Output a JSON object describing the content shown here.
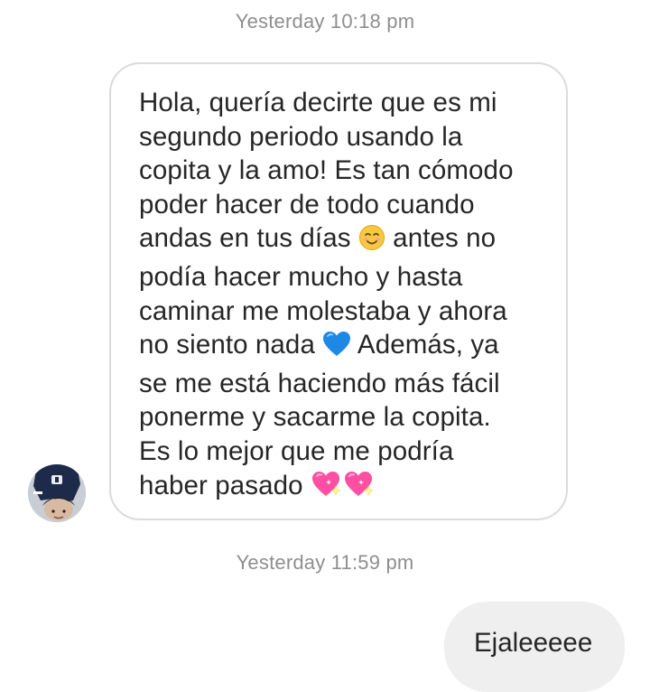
{
  "thread": {
    "timestamp_1": "Yesterday 10:18 pm",
    "timestamp_2": "Yesterday 11:59 pm"
  },
  "incoming_message": {
    "line_1": "Hola, quería decirte que es mi",
    "line_2": "segundo periodo usando la",
    "line_3": "copita y la amo! Es tan cómodo",
    "line_4": "poder hacer de todo cuando",
    "line_5a": "andas en tus días ",
    "line_5b": " antes no",
    "line_6": "podía hacer mucho y hasta",
    "line_7": "caminar me molestaba y ahora",
    "line_8a": "no siento nada ",
    "line_8b": " Además, ya",
    "line_9": "se me está haciendo más fácil",
    "line_10": "ponerme y sacarme la copita.",
    "line_11": "Es lo mejor que me podría",
    "line_12": "haber pasado ",
    "emojis": [
      "smiling-face-with-smiling-eyes",
      "blue-heart",
      "sparkling-heart",
      "sparkling-heart"
    ]
  },
  "outgoing_message": {
    "text": "Ejaleeeee"
  },
  "colors": {
    "timestamp": "#8e8e8e",
    "incoming_border": "#dbdbdb",
    "outgoing_background": "#efefef",
    "text": "#262626",
    "blue_heart": "#1e88e5",
    "sparkling_heart": "#ff4fa3",
    "smile_face": "#f7c843"
  }
}
